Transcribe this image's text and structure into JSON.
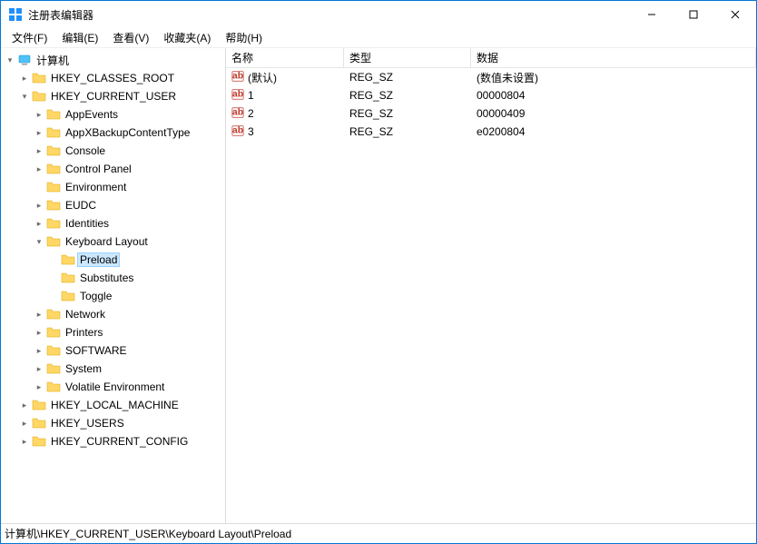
{
  "window": {
    "title": "注册表编辑器"
  },
  "menu": {
    "file": "文件(F)",
    "edit": "编辑(E)",
    "view": "查看(V)",
    "favorites": "收藏夹(A)",
    "help": "帮助(H)"
  },
  "tree": {
    "root": "计算机",
    "hives": {
      "hkcr": "HKEY_CLASSES_ROOT",
      "hkcu": "HKEY_CURRENT_USER",
      "hklm": "HKEY_LOCAL_MACHINE",
      "hku": "HKEY_USERS",
      "hkcc": "HKEY_CURRENT_CONFIG"
    },
    "hkcu_children": {
      "appevents": "AppEvents",
      "appxbackup": "AppXBackupContentType",
      "console": "Console",
      "controlpanel": "Control Panel",
      "environment": "Environment",
      "eudc": "EUDC",
      "identities": "Identities",
      "keyboardlayout": "Keyboard Layout",
      "network": "Network",
      "printers": "Printers",
      "software": "SOFTWARE",
      "system": "System",
      "volatile": "Volatile Environment"
    },
    "keyboard_children": {
      "preload": "Preload",
      "substitutes": "Substitutes",
      "toggle": "Toggle"
    }
  },
  "list": {
    "headers": {
      "name": "名称",
      "type": "类型",
      "data": "数据"
    },
    "rows": [
      {
        "name": "(默认)",
        "type": "REG_SZ",
        "data": "(数值未设置)"
      },
      {
        "name": "1",
        "type": "REG_SZ",
        "data": "00000804"
      },
      {
        "name": "2",
        "type": "REG_SZ",
        "data": "00000409"
      },
      {
        "name": "3",
        "type": "REG_SZ",
        "data": "e0200804"
      }
    ]
  },
  "statusbar": {
    "path": "计算机\\HKEY_CURRENT_USER\\Keyboard Layout\\Preload"
  }
}
